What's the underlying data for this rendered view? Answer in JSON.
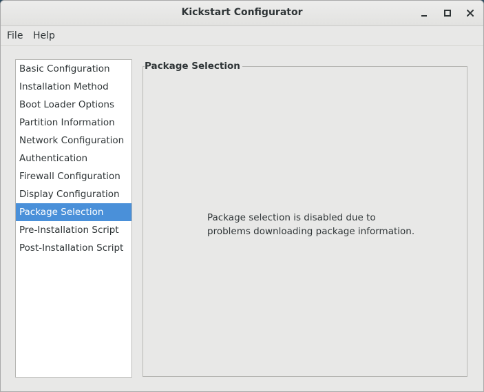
{
  "window": {
    "title": "Kickstart Configurator"
  },
  "menubar": {
    "items": [
      "File",
      "Help"
    ]
  },
  "sidebar": {
    "items": [
      {
        "label": "Basic Configuration"
      },
      {
        "label": "Installation Method"
      },
      {
        "label": "Boot Loader Options"
      },
      {
        "label": "Partition Information"
      },
      {
        "label": "Network Configuration"
      },
      {
        "label": "Authentication"
      },
      {
        "label": "Firewall Configuration"
      },
      {
        "label": "Display Configuration"
      },
      {
        "label": "Package Selection",
        "selected": true
      },
      {
        "label": "Pre-Installation Script"
      },
      {
        "label": "Post-Installation Script"
      }
    ]
  },
  "main": {
    "frame_title": "Package Selection",
    "message_line1": "Package selection is disabled due to",
    "message_line2": "problems downloading package information."
  },
  "colors": {
    "selection": "#4a90d9",
    "window_bg": "#e8e8e7"
  }
}
